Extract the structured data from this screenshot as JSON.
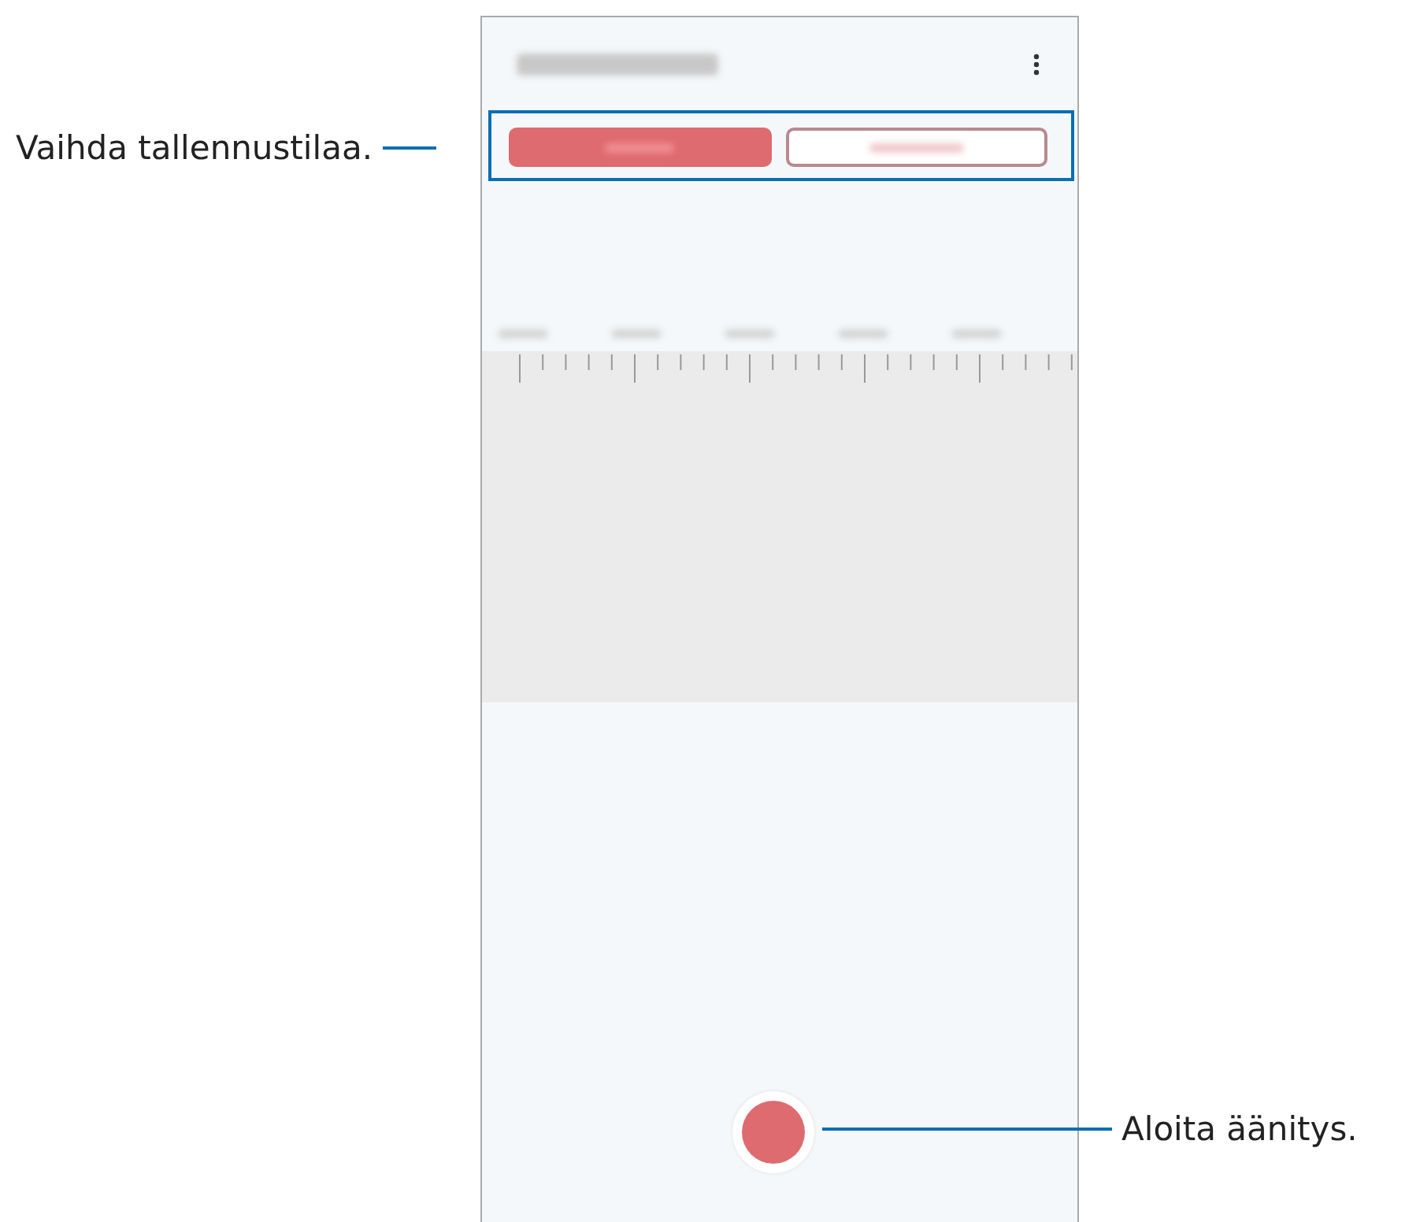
{
  "mode_tabs": [
    {
      "selected": true
    },
    {
      "selected": false
    }
  ],
  "callouts": [
    {
      "kind": "left",
      "text": "Vaihda tallennustilaa."
    },
    {
      "kind": "right",
      "text": "Aloita äänitys."
    }
  ]
}
